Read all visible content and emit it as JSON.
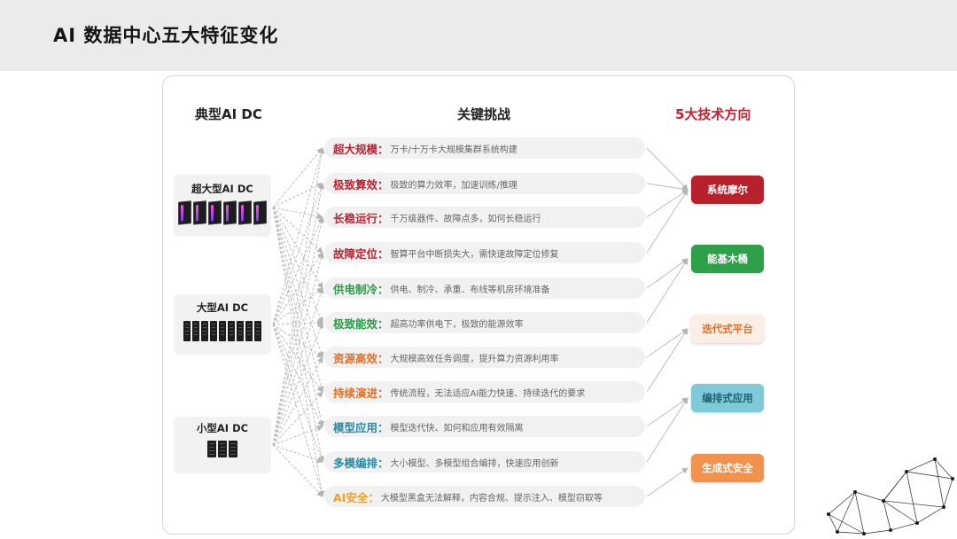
{
  "header": {
    "title": "AI 数据中心五大特征变化"
  },
  "columns": {
    "left": "典型AI DC",
    "middle": "关键挑战",
    "right": "5大技术方向"
  },
  "dc_types": [
    {
      "label": "超大型AI DC"
    },
    {
      "label": "大型AI DC"
    },
    {
      "label": "小型AI DC"
    }
  ],
  "challenges": [
    {
      "label": "超大规模：",
      "desc": "万卡/十万卡大规模集群系统构建",
      "color": "#c0202f"
    },
    {
      "label": "极致算效：",
      "desc": "极致的算力效率，加速训练/推理",
      "color": "#c0202f"
    },
    {
      "label": "长稳运行：",
      "desc": "千万级器件、故障点多，如何长稳运行",
      "color": "#c0202f"
    },
    {
      "label": "故障定位：",
      "desc": "智算平台中断损失大，需快速故障定位修复",
      "color": "#c0202f"
    },
    {
      "label": "供电制冷：",
      "desc": "供电、制冷、承重、布线等机房环境准备",
      "color": "#2e9a48"
    },
    {
      "label": "极致能效：",
      "desc": "超高功率供电下，极致的能源效率",
      "color": "#2e9a48"
    },
    {
      "label": "资源高效：",
      "desc": "大规模高效任务调度，提升算力资源利用率",
      "color": "#e0702a"
    },
    {
      "label": "持续演进：",
      "desc": "传统流程，无法适应AI能力快速、持续迭代的要求",
      "color": "#e0702a"
    },
    {
      "label": "模型应用：",
      "desc": "模型迭代快、如何和应用有效隔离",
      "color": "#2a8aa6"
    },
    {
      "label": "多模编排：",
      "desc": "大小模型、多模型组合编排，快速应用创新",
      "color": "#2a8aa6"
    },
    {
      "label": "AI安全：",
      "desc": "大模型黑盒无法解释，内容合规、提示注入、模型窃取等",
      "color": "#f0a020"
    }
  ],
  "directions": [
    {
      "label": "系统摩尔",
      "bg": "#b8202c",
      "fg": "#ffffff"
    },
    {
      "label": "能基木桶",
      "bg": "#2ea04a",
      "fg": "#ffffff"
    },
    {
      "label": "迭代式平台",
      "bg": "#fbeee4",
      "fg": "#e0702a"
    },
    {
      "label": "编排式应用",
      "bg": "#7fcad8",
      "fg": "#1f5f73"
    },
    {
      "label": "生成式安全",
      "bg": "#f3924a",
      "fg": "#ffffff"
    }
  ]
}
